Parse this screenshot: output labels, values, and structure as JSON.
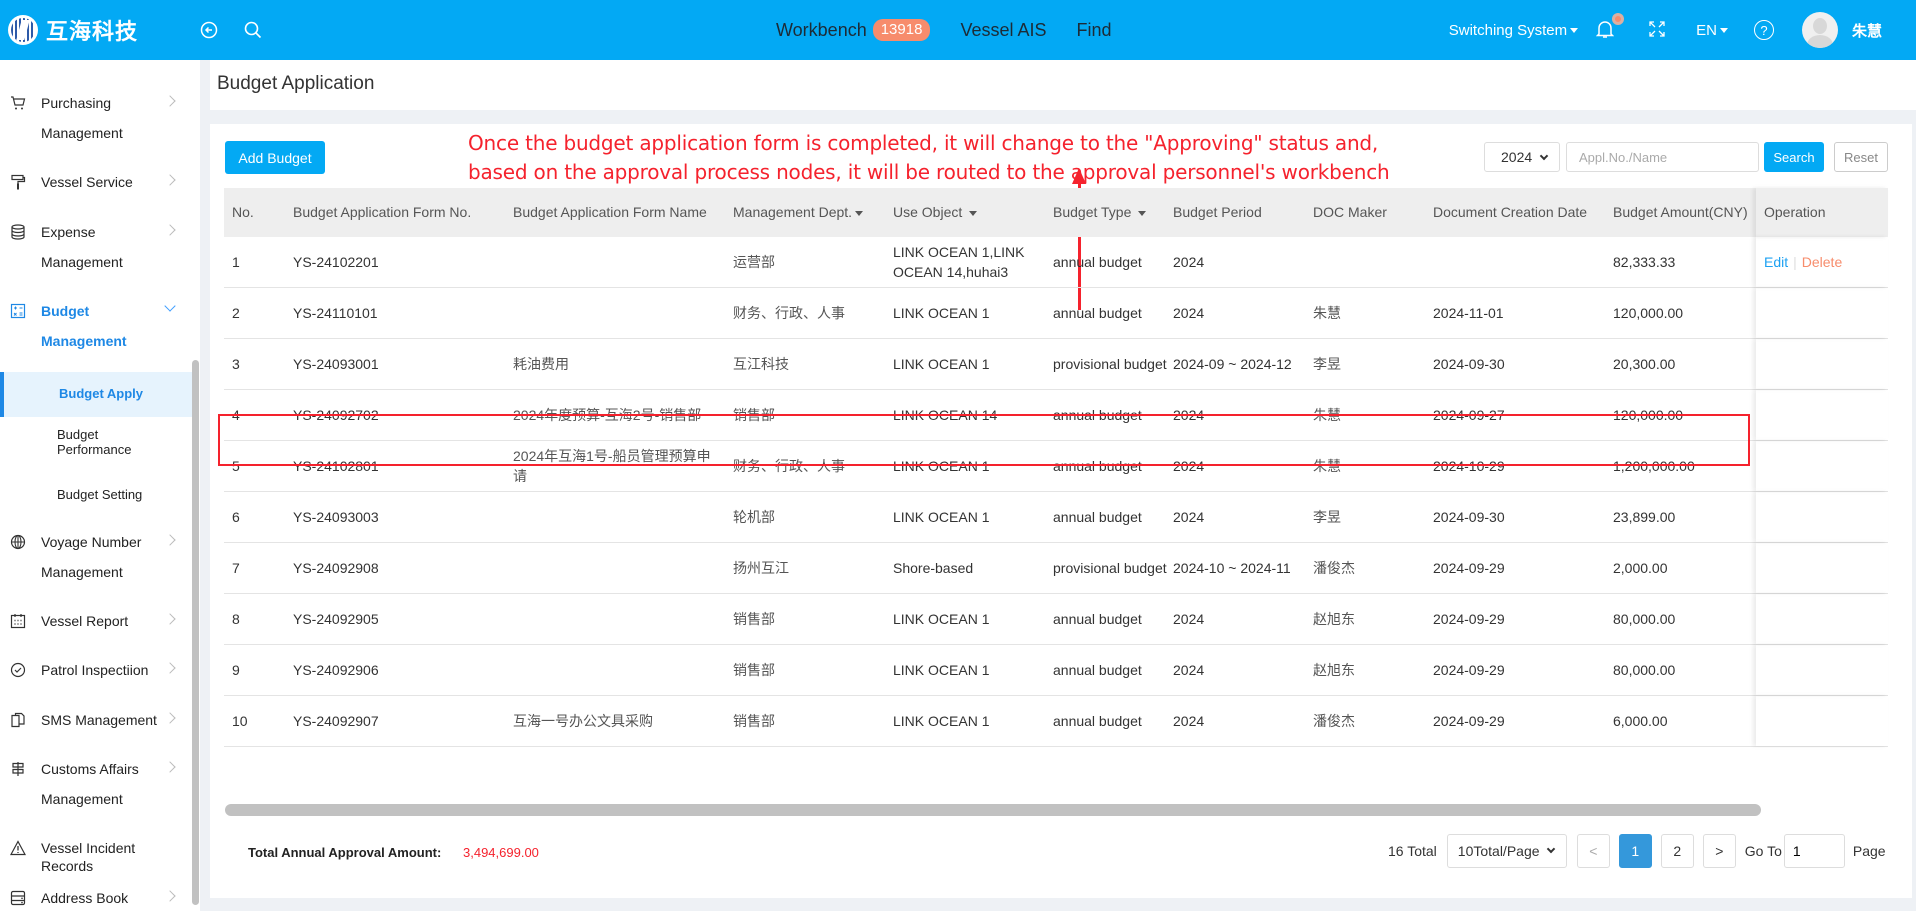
{
  "header": {
    "logo_text": "互海科技",
    "nav": [
      {
        "label": "Workbench",
        "badge": "13918"
      },
      {
        "label": "Vessel AIS"
      },
      {
        "label": "Find"
      }
    ],
    "switch_system": "Switching System",
    "language": "EN",
    "help": "?",
    "username": "朱慧",
    "colors": {
      "primary": "#03a9f4",
      "badge": "#f78c6c"
    }
  },
  "sidebar": {
    "items": [
      {
        "label": "Purchasing",
        "label2": "Management",
        "icon": "cart-icon"
      },
      {
        "label": "Vessel Service",
        "icon": "paint-roller-icon"
      },
      {
        "label": "Expense",
        "label2": "Management",
        "icon": "database-icon"
      },
      {
        "label": "Budget",
        "label2": "Management",
        "icon": "calculator-icon",
        "expanded": true
      },
      {
        "label": "Voyage Number",
        "label2": "Management",
        "icon": "globe-icon"
      },
      {
        "label": "Vessel Report",
        "icon": "calendar-icon"
      },
      {
        "label": "Patrol Inspectiion",
        "icon": "check-circle-icon"
      },
      {
        "label": "SMS Management",
        "icon": "documents-icon"
      },
      {
        "label": "Customs Affairs",
        "label2": "Management",
        "icon": "signpost-icon"
      },
      {
        "label": "Vessel Incident Records",
        "icon": "warning-icon"
      },
      {
        "label": "Address Book",
        "icon": "server-icon"
      }
    ],
    "sub_items": [
      {
        "label": "Budget Apply",
        "active": true
      },
      {
        "label": "Budget",
        "label2": "Performance"
      },
      {
        "label": "Budget Setting"
      }
    ]
  },
  "page": {
    "title": "Budget Application",
    "add_button": "Add Budget",
    "annotation_line1": "Once the budget application form is completed, it will change to the \"Approving\" status and,",
    "annotation_line2": "based on the approval process nodes, it will be routed to the approval personnel's workbench",
    "filters": {
      "year": "2024",
      "search_placeholder": "Appl.No./Name",
      "search_value": "",
      "search_button": "Search",
      "reset_button": "Reset"
    }
  },
  "table": {
    "columns": [
      "No.",
      "Budget Application Form No.",
      "Budget Application Form Name",
      "Management Dept.",
      "Use Object",
      "Budget Type",
      "Budget Period",
      "DOC Maker",
      "Document Creation Date",
      "Budget Amount(CNY)",
      "Operation"
    ],
    "rows": [
      {
        "no": "1",
        "form_no": "YS-24102201",
        "name": "",
        "dept": "运营部",
        "use_object": "LINK OCEAN 1,LINK OCEAN 14,huhai3",
        "type": "annual budget",
        "period": "2024",
        "maker": "",
        "date": "",
        "amount": "82,333.33",
        "edit": "Edit",
        "delete": "Delete"
      },
      {
        "no": "2",
        "form_no": "YS-24110101",
        "name": "",
        "dept": "财务、行政、人事",
        "use_object": "LINK OCEAN 1",
        "type": "annual budget",
        "period": "2024",
        "maker": "朱慧",
        "date": "2024-11-01",
        "amount": "120,000.00"
      },
      {
        "no": "3",
        "form_no": "YS-24093001",
        "name": "耗油费用",
        "dept": "互江科技",
        "use_object": "LINK OCEAN 1",
        "type": "provisional budget",
        "period": "2024-09 ~ 2024-12",
        "maker": "李昱",
        "date": "2024-09-30",
        "amount": "20,300.00"
      },
      {
        "no": "4",
        "form_no": "YS-24092702",
        "name": "2024年度预算-互海2号-销售部",
        "dept": "销售部",
        "use_object": "LINK OCEAN 14",
        "type": "annual budget",
        "period": "2024",
        "maker": "朱慧",
        "date": "2024-09-27",
        "amount": "120,000.00"
      },
      {
        "no": "5",
        "form_no": "YS-24102801",
        "name": "2024年互海1号-船员管理预算申请",
        "dept": "财务、行政、人事",
        "use_object": "LINK OCEAN 1",
        "type": "annual budget",
        "period": "2024",
        "maker": "朱慧",
        "date": "2024-10-29",
        "amount": "1,200,000.00"
      },
      {
        "no": "6",
        "form_no": "YS-24093003",
        "name": "",
        "dept": "轮机部",
        "use_object": "LINK OCEAN 1",
        "type": "annual budget",
        "period": "2024",
        "maker": "李昱",
        "date": "2024-09-30",
        "amount": "23,899.00"
      },
      {
        "no": "7",
        "form_no": "YS-24092908",
        "name": "",
        "dept": "扬州互江",
        "use_object": "Shore-based",
        "type": "provisional budget",
        "period": "2024-10 ~ 2024-11",
        "maker": "潘俊杰",
        "date": "2024-09-29",
        "amount": "2,000.00"
      },
      {
        "no": "8",
        "form_no": "YS-24092905",
        "name": "",
        "dept": "销售部",
        "use_object": "LINK OCEAN 1",
        "type": "annual budget",
        "period": "2024",
        "maker": "赵旭东",
        "date": "2024-09-29",
        "amount": "80,000.00"
      },
      {
        "no": "9",
        "form_no": "YS-24092906",
        "name": "",
        "dept": "销售部",
        "use_object": "LINK OCEAN 1",
        "type": "annual budget",
        "period": "2024",
        "maker": "赵旭东",
        "date": "2024-09-29",
        "amount": "80,000.00"
      },
      {
        "no": "10",
        "form_no": "YS-24092907",
        "name": "互海一号办公文具采购",
        "dept": "销售部",
        "use_object": "LINK OCEAN 1",
        "type": "annual budget",
        "period": "2024",
        "maker": "潘俊杰",
        "date": "2024-09-29",
        "amount": "6,000.00"
      }
    ]
  },
  "footer": {
    "total_label": "Total Annual Approval Amount:",
    "total_value": "3,494,699.00",
    "pager": {
      "total": "16 Total",
      "page_size": "10Total/Page",
      "prev": "<",
      "pages": [
        "1",
        "2"
      ],
      "current": "1",
      "next": ">",
      "goto_label": "Go To",
      "goto_value": "1",
      "page_label": "Page"
    }
  }
}
